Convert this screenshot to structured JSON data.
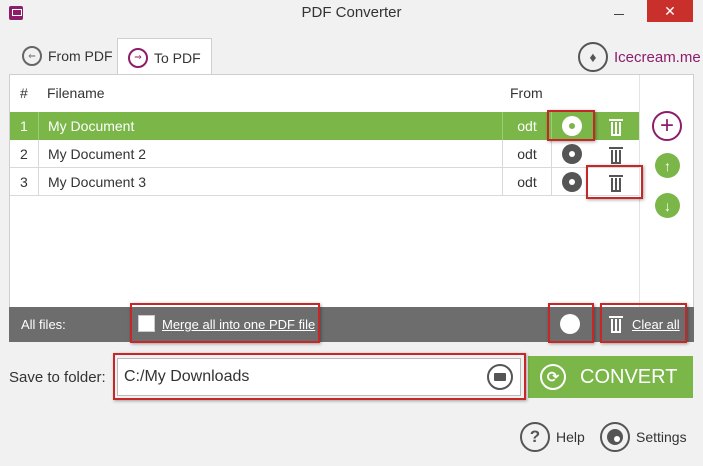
{
  "window": {
    "title": "PDF Converter",
    "close_glyph": "✕"
  },
  "tabs": [
    {
      "label": "From PDF",
      "icon": "from-pdf-icon",
      "active": false
    },
    {
      "label": "To PDF",
      "icon": "to-pdf-icon",
      "active": true
    }
  ],
  "brand": {
    "text": "Icecream.me",
    "color": "#8b1d6b"
  },
  "table": {
    "headers": {
      "num": "#",
      "filename": "Filename",
      "from": "From"
    },
    "rows": [
      {
        "num": "1",
        "filename": "My Document",
        "from": "odt",
        "selected": true
      },
      {
        "num": "2",
        "filename": "My Document 2",
        "from": "odt",
        "selected": false
      },
      {
        "num": "3",
        "filename": "My Document 3",
        "from": "odt",
        "selected": false
      }
    ]
  },
  "side_buttons": {
    "add": "+",
    "up": "↑",
    "down": "↓"
  },
  "all_files": {
    "label": "All files:",
    "merge_label": "Merge all into one PDF file",
    "merge_checked": false,
    "clear_label": "Clear all"
  },
  "save": {
    "label": "Save to folder:",
    "folder": "C:/My Downloads"
  },
  "convert": {
    "label": "CONVERT",
    "icon_glyph": "⟳"
  },
  "bottom": {
    "help_label": "Help",
    "help_glyph": "?",
    "settings_label": "Settings"
  },
  "colors": {
    "accent_green": "#7ab648",
    "brand_purple": "#8b1d6b",
    "highlight_red": "#c62828",
    "bar_gray": "#6d6d6d"
  }
}
